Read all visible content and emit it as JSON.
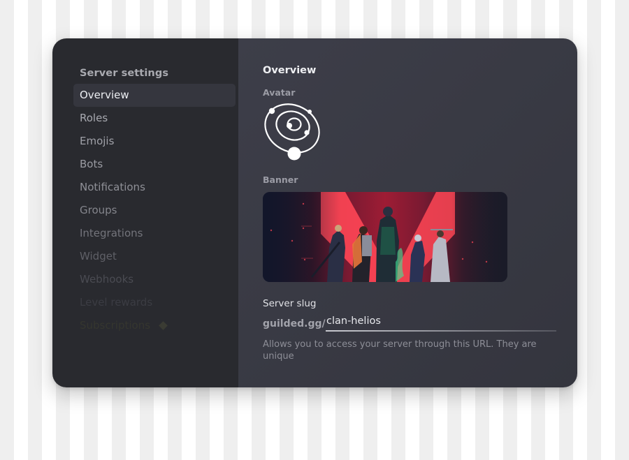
{
  "sidebar": {
    "title": "Server settings",
    "items": [
      {
        "label": "Overview",
        "active": true,
        "color": "#eceef2"
      },
      {
        "label": "Roles",
        "active": false,
        "color": "#a8a9b0"
      },
      {
        "label": "Emojis",
        "active": false,
        "color": "#a0a1a8"
      },
      {
        "label": "Bots",
        "active": false,
        "color": "#9a9ba2"
      },
      {
        "label": "Notifications",
        "active": false,
        "color": "#8f9097"
      },
      {
        "label": "Groups",
        "active": false,
        "color": "#84858c"
      },
      {
        "label": "Integrations",
        "active": false,
        "color": "#73747b"
      },
      {
        "label": "Widget",
        "active": false,
        "color": "#5f6067"
      },
      {
        "label": "Webhooks",
        "active": false,
        "color": "#4a4b52"
      },
      {
        "label": "Level rewards",
        "active": false,
        "color": "#3b3c43"
      },
      {
        "label": "Subscriptions",
        "active": false,
        "color": "#35362f",
        "icon": "gem-icon"
      }
    ]
  },
  "main": {
    "title": "Overview",
    "avatar": {
      "label": "Avatar",
      "icon": "orbit-icon"
    },
    "banner": {
      "label": "Banner",
      "image": "banner-image"
    },
    "slug": {
      "label": "Server slug",
      "prefix": "guilded.gg/",
      "value": "clan-helios"
    },
    "help_text": "Allows you to access your server through this URL. They are unique"
  },
  "colors": {
    "sidebar_bg": "#292a2f",
    "main_bg": "#3a3b45",
    "active_item_bg": "#35363e",
    "banner_accent": "#ff4655"
  }
}
